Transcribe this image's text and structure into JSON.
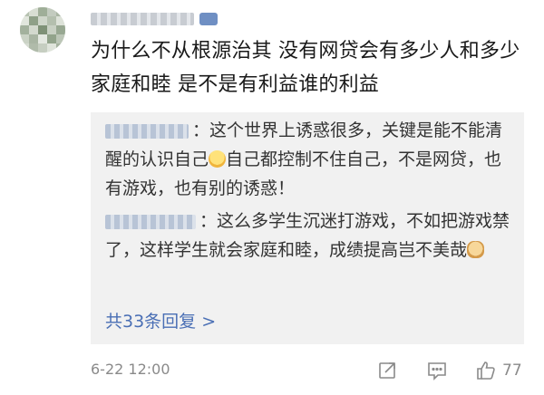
{
  "comment": {
    "author_name": "",
    "text": "为什么不从根源治其 没有网贷会有多少人和多少家庭和睦 是不是有利益谁的利益",
    "timestamp": "6-22 12:00",
    "like_count": "77"
  },
  "replies": [
    {
      "author_name": "",
      "text_before_emoji": "：这个世界上诱惑很多，关键是能不能清醒的认识自己",
      "emoji": "smiley-face-icon",
      "text_after_emoji": "自己都控制不住自己，不是网贷，也有游戏，也有别的诱惑！"
    },
    {
      "author_name": "",
      "text_before_emoji": "：这么多学生沉迷打游戏，不如把游戏禁了，这样学生就会家庭和睦，成绩提高岂不美哉",
      "emoji": "doge-emoji-icon",
      "text_after_emoji": ""
    }
  ],
  "more_replies_label": "共33条回复",
  "more_replies_chevron": ">",
  "icons": {
    "share": "share-icon",
    "comment": "comment-icon",
    "like": "thumbs-up-icon"
  },
  "colors": {
    "link": "#4a6fb5",
    "muted": "#8a8a8a",
    "reply_bg": "#f1f1f1"
  }
}
